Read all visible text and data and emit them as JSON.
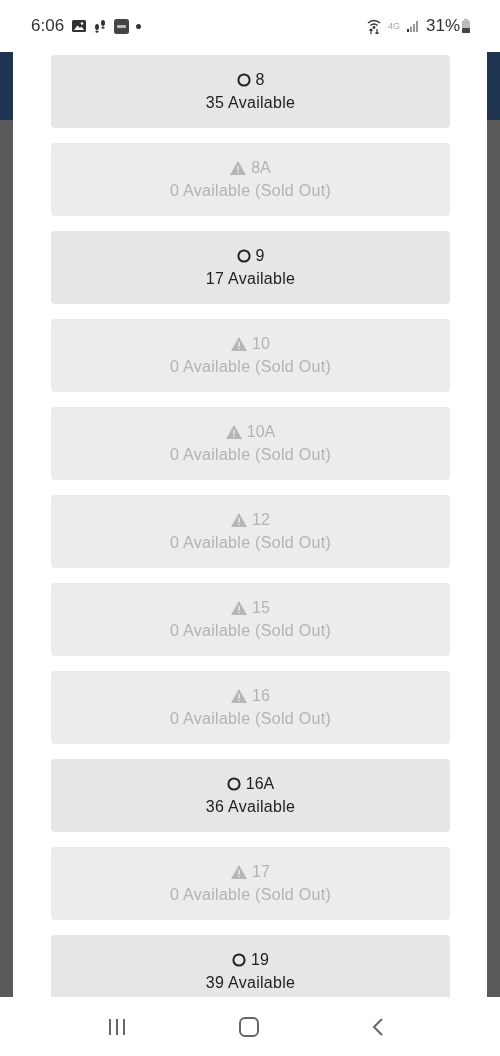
{
  "status_bar": {
    "time": "6:06",
    "network": "4G",
    "battery": "31%"
  },
  "sections": [
    {
      "kind": "available",
      "name": "8",
      "availability": "35 Available"
    },
    {
      "kind": "sold_out",
      "name": "8A",
      "availability": "0 Available (Sold Out)"
    },
    {
      "kind": "available",
      "name": "9",
      "availability": "17 Available"
    },
    {
      "kind": "sold_out",
      "name": "10",
      "availability": "0 Available (Sold Out)"
    },
    {
      "kind": "sold_out",
      "name": "10A",
      "availability": "0 Available (Sold Out)"
    },
    {
      "kind": "sold_out",
      "name": "12",
      "availability": "0 Available (Sold Out)"
    },
    {
      "kind": "sold_out",
      "name": "15",
      "availability": "0 Available (Sold Out)"
    },
    {
      "kind": "sold_out",
      "name": "16",
      "availability": "0 Available (Sold Out)"
    },
    {
      "kind": "available",
      "name": "16A",
      "availability": "36 Available"
    },
    {
      "kind": "sold_out",
      "name": "17",
      "availability": "0 Available (Sold Out)"
    },
    {
      "kind": "available",
      "name": "19",
      "availability": "39 Available"
    }
  ]
}
